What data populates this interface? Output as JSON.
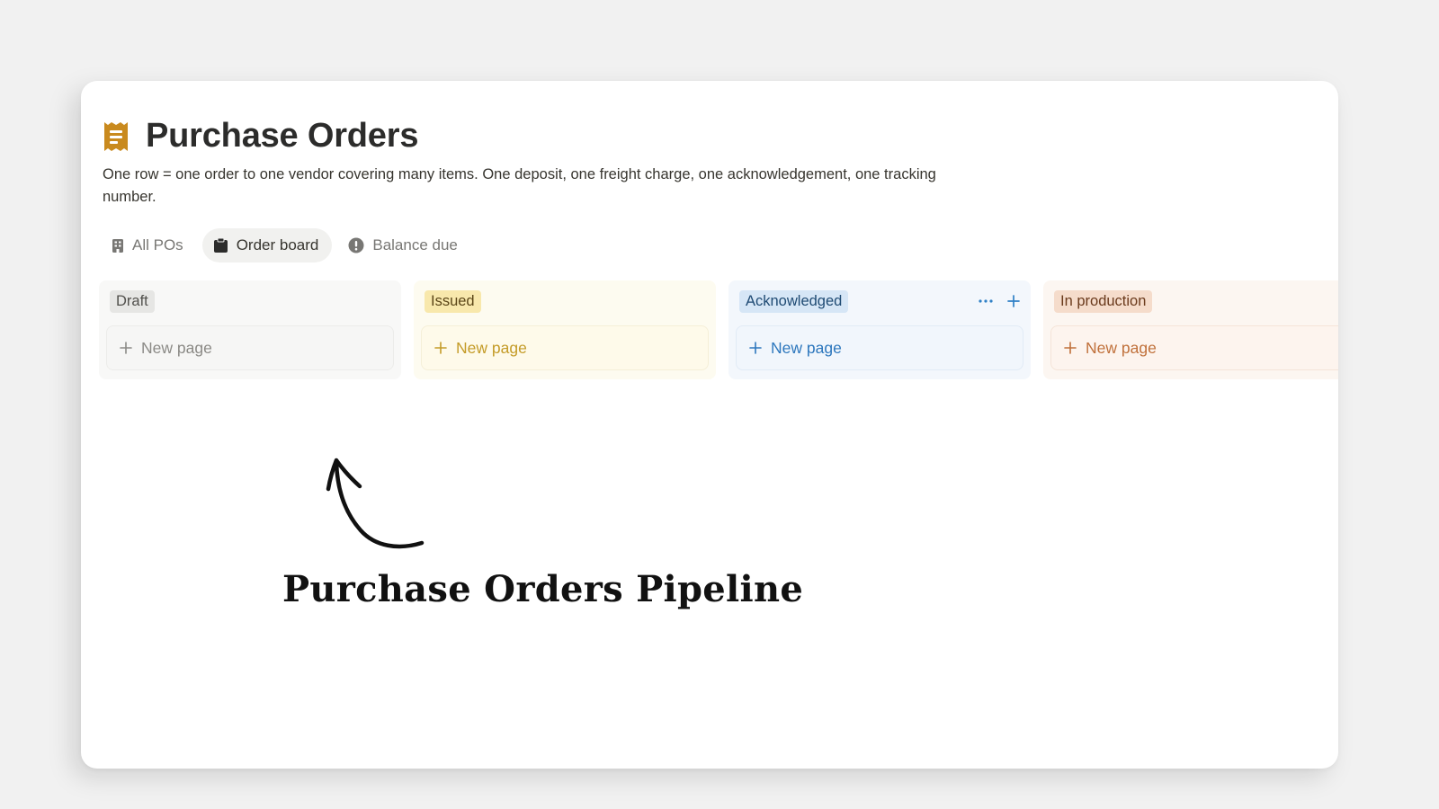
{
  "page": {
    "title": "Purchase Orders",
    "title_icon": "receipt-icon",
    "description": "One row = one order to one vendor covering many items. One deposit, one freight charge, one acknowledgement, one tracking number."
  },
  "tabs": [
    {
      "label": "All POs",
      "icon": "building-icon",
      "active": false
    },
    {
      "label": "Order board",
      "icon": "clipboard-icon",
      "active": true
    },
    {
      "label": "Balance due",
      "icon": "alert-circle-icon",
      "active": false
    }
  ],
  "board": {
    "columns": [
      {
        "status": "Draft",
        "new_page_label": "New page",
        "color": "#e6e6e4"
      },
      {
        "status": "Issued",
        "new_page_label": "New page",
        "color": "#f8e8ac"
      },
      {
        "status": "Acknowledged",
        "new_page_label": "New page",
        "color": "#d6e6f6"
      },
      {
        "status": "In production",
        "new_page_label": "New page",
        "color": "#f5dccb"
      }
    ]
  },
  "annotation": {
    "label": "Purchase Orders Pipeline"
  },
  "colors": {
    "icon_gold": "#c98a1e",
    "accent_blue": "#2f80c6"
  }
}
